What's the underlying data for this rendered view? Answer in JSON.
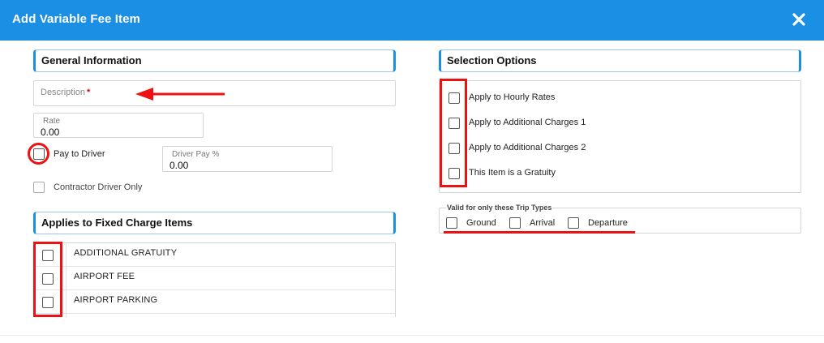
{
  "dialog": {
    "title": "Add Variable Fee Item",
    "close_icon": "close-icon"
  },
  "general": {
    "heading": "General Information",
    "description_placeholder": "Description",
    "required_marker": "*",
    "rate_label": "Rate",
    "rate_value": "0.00",
    "pay_to_driver_label": "Pay to Driver",
    "pay_to_driver_checked": false,
    "driver_pay_label": "Driver Pay %",
    "driver_pay_value": "0.00",
    "contractor_only_label": "Contractor Driver Only",
    "contractor_only_checked": false
  },
  "fixed_charges": {
    "heading": "Applies to Fixed Charge Items",
    "items": [
      {
        "label": "ADDITIONAL GRATUITY",
        "checked": false
      },
      {
        "label": "AIRPORT FEE",
        "checked": false
      },
      {
        "label": "AIRPORT PARKING",
        "checked": false
      }
    ]
  },
  "selection": {
    "heading": "Selection Options",
    "options": [
      {
        "label": "Apply to Hourly Rates",
        "checked": false
      },
      {
        "label": "Apply to Additional Charges 1",
        "checked": false
      },
      {
        "label": "Apply to Additional Charges 2",
        "checked": false
      },
      {
        "label": "This Item is a Gratuity",
        "checked": false
      }
    ]
  },
  "trip_types": {
    "legend": "Valid for only these Trip Types",
    "types": [
      {
        "label": "Ground",
        "checked": false
      },
      {
        "label": "Arrival",
        "checked": false
      },
      {
        "label": "Departure",
        "checked": false
      }
    ]
  },
  "colors": {
    "header": "#1a8fe3",
    "accent": "#1a8fe3",
    "annotation": "#ee1111",
    "required": "#d0021b"
  }
}
